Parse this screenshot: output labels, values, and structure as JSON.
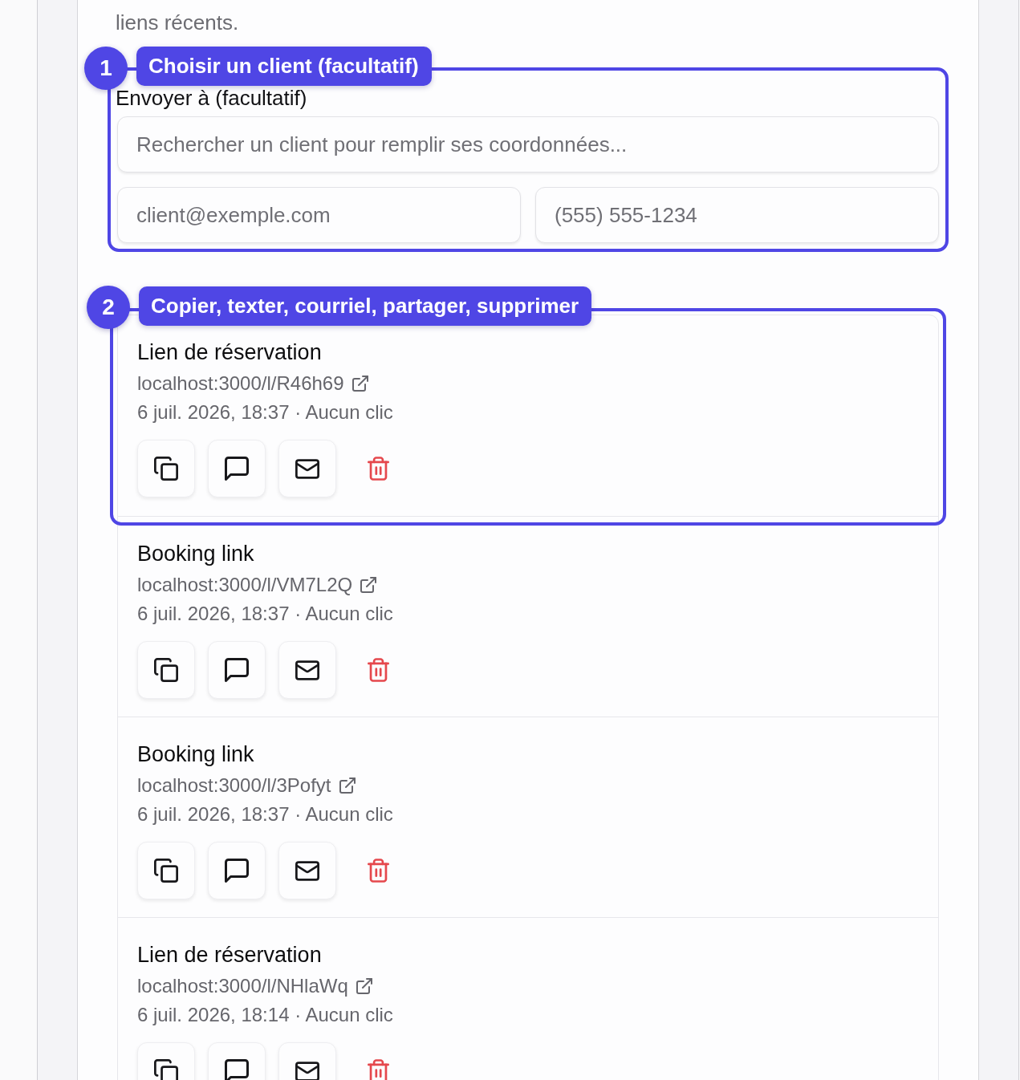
{
  "intro": {
    "text": "liens récents."
  },
  "recipient_form": {
    "callout": {
      "number": "1",
      "label": "Choisir un client (facultatif)"
    },
    "label": "Envoyer à (facultatif)",
    "search": {
      "placeholder": "Rechercher un client pour remplir ses coordonnées..."
    },
    "email": {
      "placeholder": "client@exemple.com"
    },
    "phone": {
      "placeholder": "(555) 555-1234"
    }
  },
  "recent_links": {
    "callout": {
      "number": "2",
      "label": "Copier, texter, courriel, partager, supprimer"
    },
    "actions": [
      {
        "kind": "copy"
      },
      {
        "kind": "sms"
      },
      {
        "kind": "email"
      },
      {
        "kind": "delete"
      }
    ],
    "items": [
      {
        "title": "Lien de réservation",
        "url": "localhost:3000/l/R46h69",
        "meta": "6 juil. 2026, 18:37 · Aucun clic"
      },
      {
        "title": "Booking link",
        "url": "localhost:3000/l/VM7L2Q",
        "meta": "6 juil. 2026, 18:37 · Aucun clic"
      },
      {
        "title": "Booking link",
        "url": "localhost:3000/l/3Pofyt",
        "meta": "6 juil. 2026, 18:37 · Aucun clic"
      },
      {
        "title": "Lien de réservation",
        "url": "localhost:3000/l/NHlaWq",
        "meta": "6 juil. 2026, 18:14 · Aucun clic"
      }
    ]
  }
}
